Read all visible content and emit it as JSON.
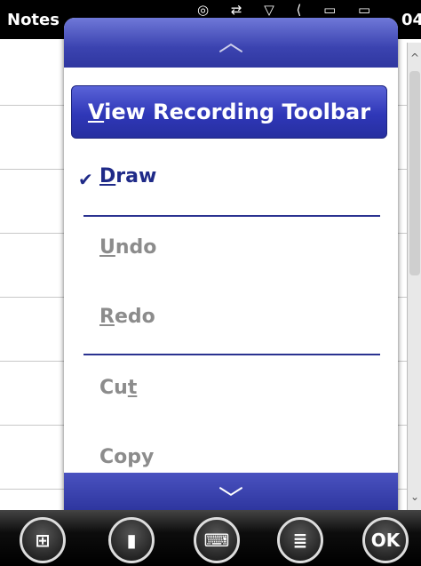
{
  "titlebar": {
    "title": "Notes",
    "status_icons": "◎ ⇄ ▽ ⟨ ▭ ▭",
    "clock": "04"
  },
  "menu": {
    "scroll_up_glyph": "︿",
    "scroll_down_glyph": "﹀",
    "toolbar_button": {
      "mnemonic": "V",
      "rest": "iew Recording Toolbar"
    },
    "check_glyph": "✔",
    "items": [
      {
        "label_pre": "",
        "mnemonic": "D",
        "label_post": "raw",
        "state": "active",
        "checked": true
      },
      {
        "label_pre": "",
        "mnemonic": "U",
        "label_post": "ndo",
        "state": "disabled"
      },
      {
        "label_pre": "",
        "mnemonic": "R",
        "label_post": "edo",
        "state": "disabled"
      },
      {
        "label_pre": "Cu",
        "mnemonic": "t",
        "label_post": "",
        "state": "disabled"
      },
      {
        "label_pre": "Copy",
        "mnemonic": "",
        "label_post": "",
        "state": "disabled"
      }
    ]
  },
  "scrollbar": {
    "up_glyph": "^",
    "down_glyph": "⌄"
  },
  "softbar": {
    "start_glyph": "⊞",
    "note_glyph": "▮",
    "keyboard_glyph": "⌨",
    "menu_glyph": "≣",
    "ok_label": "OK"
  },
  "colors": {
    "menu_header": "#3b43b0",
    "accent": "#1f2a88",
    "disabled": "#8c8c8c"
  }
}
